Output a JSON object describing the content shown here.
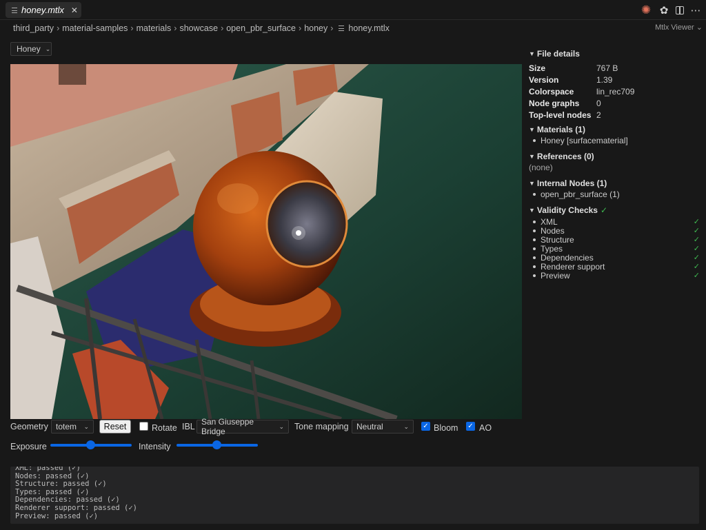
{
  "tab": {
    "icon": "file-lines-icon",
    "title": "honey.mtlx",
    "close": "✕"
  },
  "topbar_icons": [
    "claude-icon",
    "openai-icon",
    "split-editor-icon",
    "more-icon"
  ],
  "breadcrumb": {
    "items": [
      "third_party",
      "material-samples",
      "materials",
      "showcase",
      "open_pbr_surface",
      "honey"
    ],
    "file": "honey.mtlx",
    "separator": "›"
  },
  "viewer_label": "Mtlx Viewer ⌄",
  "material_select": {
    "value": "Honey"
  },
  "controls": {
    "geometry_label": "Geometry",
    "geometry_value": "totem",
    "reset_label": "Reset",
    "rotate_label": "Rotate",
    "rotate_checked": false,
    "ibl_label": "IBL",
    "ibl_value": "San Giuseppe Bridge",
    "tonemap_label": "Tone mapping",
    "tonemap_value": "Neutral",
    "bloom_label": "Bloom",
    "bloom_checked": true,
    "ao_label": "AO",
    "ao_checked": true,
    "exposure_label": "Exposure",
    "exposure_level": 0.5,
    "intensity_label": "Intensity",
    "intensity_level": 0.5
  },
  "details": {
    "file_details_title": "File details",
    "rows": [
      {
        "k": "Size",
        "v": "767 B"
      },
      {
        "k": "Version",
        "v": "1.39"
      },
      {
        "k": "Colorspace",
        "v": "lin_rec709"
      },
      {
        "k": "Node graphs",
        "v": "0"
      },
      {
        "k": "Top-level nodes",
        "v": "2"
      }
    ],
    "materials_title": "Materials (1)",
    "materials": [
      "Honey [surfacematerial]"
    ],
    "references_title": "References (0)",
    "references_none": "(none)",
    "internal_title": "Internal Nodes (1)",
    "internal": [
      "open_pbr_surface (1)"
    ],
    "validity_title": "Validity Checks",
    "validity_mark": "✓",
    "checks": [
      "XML",
      "Nodes",
      "Structure",
      "Types",
      "Dependencies",
      "Renderer support",
      "Preview"
    ]
  },
  "log": [
    "XML: passed (✓)",
    "Nodes: passed (✓)",
    "Structure: passed (✓)",
    "Types: passed (✓)",
    "Dependencies: passed (✓)",
    "Renderer support: passed (✓)",
    "Preview: passed (✓)"
  ],
  "colors": {
    "accent": "#0a66e4",
    "ok": "#3fb950",
    "background": "#181818"
  }
}
